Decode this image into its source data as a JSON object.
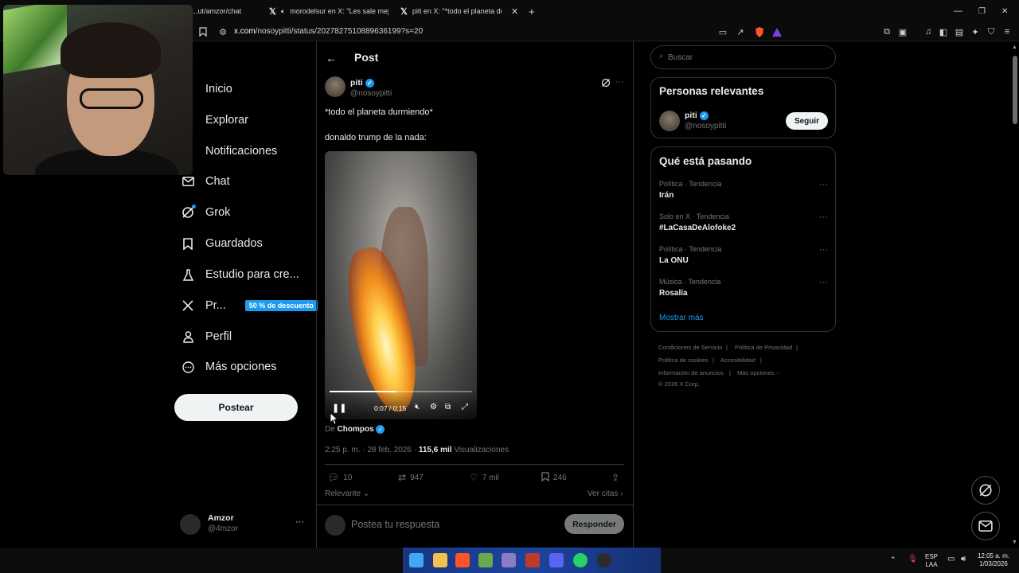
{
  "browser": {
    "tabs": [
      {
        "title": "...ut/amzor/chat"
      },
      {
        "title": "morodelsur en X: \"Les sale mejor"
      },
      {
        "title": "piti en X: \"*todo el planeta durmi"
      }
    ],
    "new_tab": "+",
    "url_domain": "x.com",
    "url_path": "/nosoypitti/status/2027827510889636199?s=20",
    "window_controls": [
      "—",
      "❐",
      "✕"
    ]
  },
  "nav": {
    "items": [
      {
        "label": "Inicio",
        "icon": "home-icon"
      },
      {
        "label": "Explorar",
        "icon": "search-icon"
      },
      {
        "label": "Notificaciones",
        "icon": "bell-icon"
      },
      {
        "label": "Chat",
        "icon": "mail-icon"
      },
      {
        "label": "Grok",
        "icon": "grok-icon"
      },
      {
        "label": "Guardados",
        "icon": "bookmark-icon"
      },
      {
        "label": "Estudio para cre...",
        "icon": "flask-icon"
      },
      {
        "label": "Pr...",
        "icon": "x-logo-icon"
      },
      {
        "label": "Perfil",
        "icon": "person-icon"
      },
      {
        "label": "Más opciones",
        "icon": "more-circle-icon"
      }
    ],
    "promo_badge": "50 % de descuento",
    "post_button": "Postear",
    "account": {
      "name": "Amzor",
      "handle": "@4mzor",
      "more": "···"
    }
  },
  "post": {
    "header_title": "Post",
    "back": "←",
    "author_name": "piti",
    "author_handle": "@nosoypitti",
    "text_line1": "*todo el planeta durmiendo*",
    "text_line2": "donaldo trump de la nada:",
    "video": {
      "time": "0:07 / 0:15",
      "progress_fraction": 0.47
    },
    "from_prefix": "De",
    "from_name": "Chompos",
    "timestamp": "2:25 p. m. · 28 feb. 2026 ·",
    "views_count": "115,6 mil",
    "views_label": "Visualizaciones",
    "actions": {
      "replies": "10",
      "reposts": "947",
      "likes": "7 mil",
      "bookmarks": "246"
    },
    "sort_label": "Relevante",
    "quotes_label": "Ver citas",
    "reply_placeholder": "Postea tu respuesta",
    "reply_button": "Responder"
  },
  "sidebar": {
    "search_placeholder": "Buscar",
    "relevant_title": "Personas relevantes",
    "relevant_user": {
      "name": "piti",
      "handle": "@nosoypitti",
      "follow": "Seguir"
    },
    "trends_title": "Qué está pasando",
    "trends": [
      {
        "meta": "Política · Tendencia",
        "name": "Irán"
      },
      {
        "meta": "Solo en X · Tendencia",
        "name": "#LaCasaDeAlofoke2"
      },
      {
        "meta": "Política · Tendencia",
        "name": "La ONU"
      },
      {
        "meta": "Música · Tendencia",
        "name": "Rosalía"
      }
    ],
    "show_more": "Mostrar más",
    "footer": {
      "terms": "Condiciones de Servicio",
      "privacy": "Política de Privacidad",
      "cookies": "Política de cookies",
      "accessibility": "Accesibilidad",
      "ads": "Información de anuncios",
      "more": "Más opciones ···",
      "copyright": "© 2026 X Corp."
    }
  },
  "taskbar": {
    "lang": "ESP",
    "lang_sub": "LAA",
    "time": "12:05 a. m.",
    "date": "1/03/2026"
  },
  "colors": {
    "accent": "#1d9bf0",
    "background": "#000000",
    "text": "#e7e9ea",
    "muted": "#71767b"
  }
}
